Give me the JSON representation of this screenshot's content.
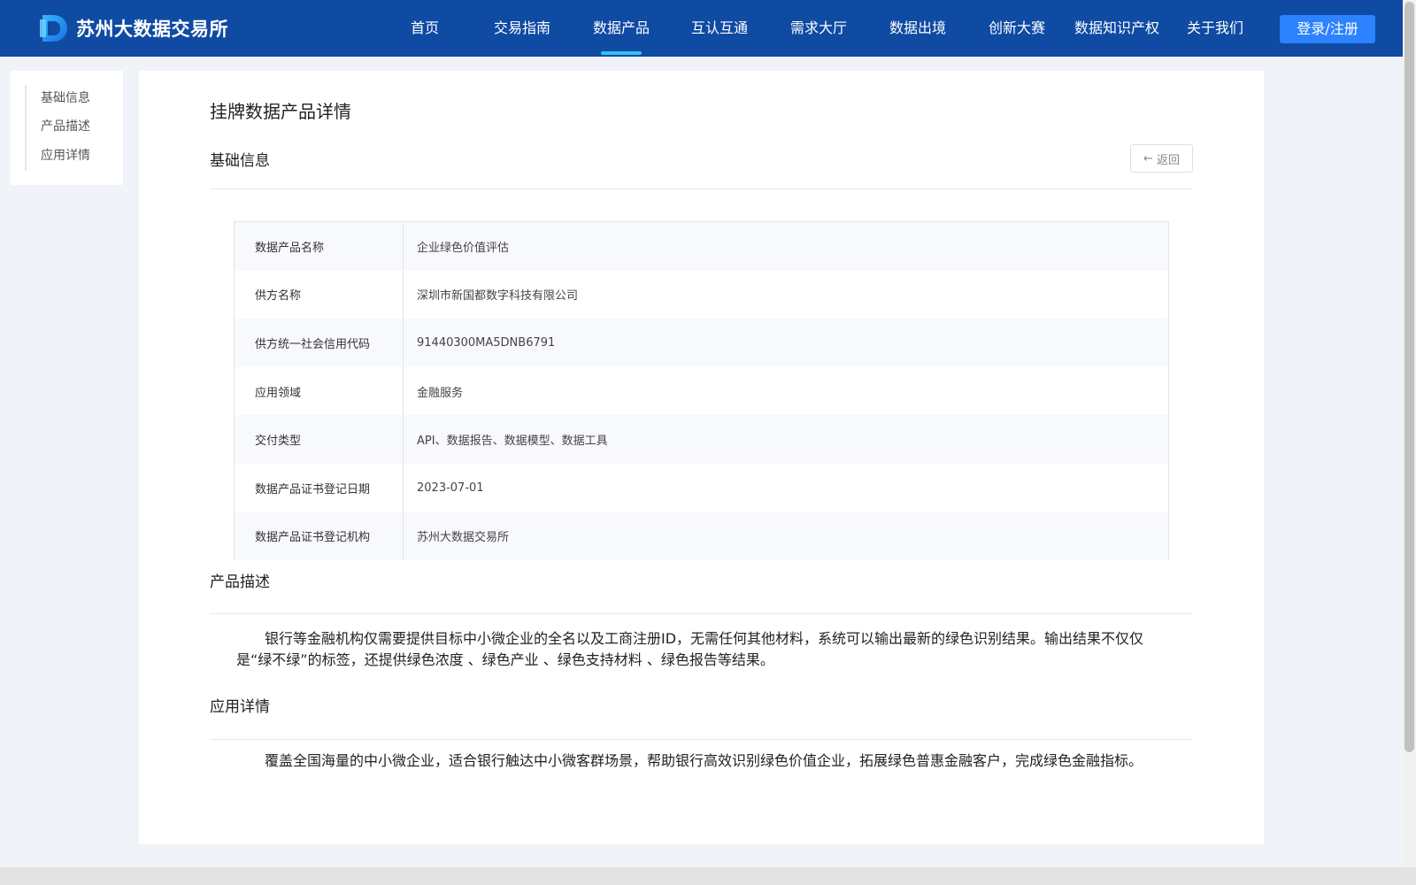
{
  "header": {
    "logo_text": "苏州大数据交易所",
    "nav": [
      {
        "label": "首页",
        "active": false
      },
      {
        "label": "交易指南",
        "active": false
      },
      {
        "label": "数据产品",
        "active": true
      },
      {
        "label": "互认互通",
        "active": false
      },
      {
        "label": "需求大厅",
        "active": false
      },
      {
        "label": "数据出境",
        "active": false
      },
      {
        "label": "创新大赛",
        "active": false
      },
      {
        "label": "数据知识产权",
        "active": false
      },
      {
        "label": "关于我们",
        "active": false
      }
    ],
    "login_label": "登录/注册"
  },
  "side_nav": {
    "items": [
      {
        "label": "基础信息"
      },
      {
        "label": "产品描述"
      },
      {
        "label": "应用详情"
      }
    ]
  },
  "main": {
    "page_title": "挂牌数据产品详情",
    "basic_section_title": "基础信息",
    "back_label": "返回",
    "back_icon": "arrow-left-icon",
    "info_rows": [
      {
        "label": "数据产品名称",
        "value": "企业绿色价值评估"
      },
      {
        "label": "供方名称",
        "value": "深圳市新国都数字科技有限公司"
      },
      {
        "label": "供方统一社会信用代码",
        "value": "91440300MA5DNB6791"
      },
      {
        "label": "应用领域",
        "value": "金融服务"
      },
      {
        "label": "交付类型",
        "value": "API、数据报告、数据模型、数据工具"
      },
      {
        "label": "数据产品证书登记日期",
        "value": "2023-07-01"
      },
      {
        "label": "数据产品证书登记机构",
        "value": "苏州大数据交易所"
      }
    ],
    "description_title": "产品描述",
    "description_text": "银行等金融机构仅需要提供目标中小微企业的全名以及工商注册ID，无需任何其他材料，系统可以输出最新的绿色识别结果。输出结果不仅仅是“绿不绿”的标签，还提供绿色浓度 、绿色产业 、绿色支持材料 、绿色报告等结果。",
    "application_title": "应用详情",
    "application_text": "覆盖全国海量的中小微企业，适合银行触达中小微客群场景，帮助银行高效识别绿色价值企业，拓展绿色普惠金融客户，完成绿色金融指标。"
  },
  "colors": {
    "header_bg": "#0f4aa3",
    "active_indicator": "#2fc2f0",
    "login_button": "#2c82ff",
    "page_bg": "#f0f3f8"
  }
}
